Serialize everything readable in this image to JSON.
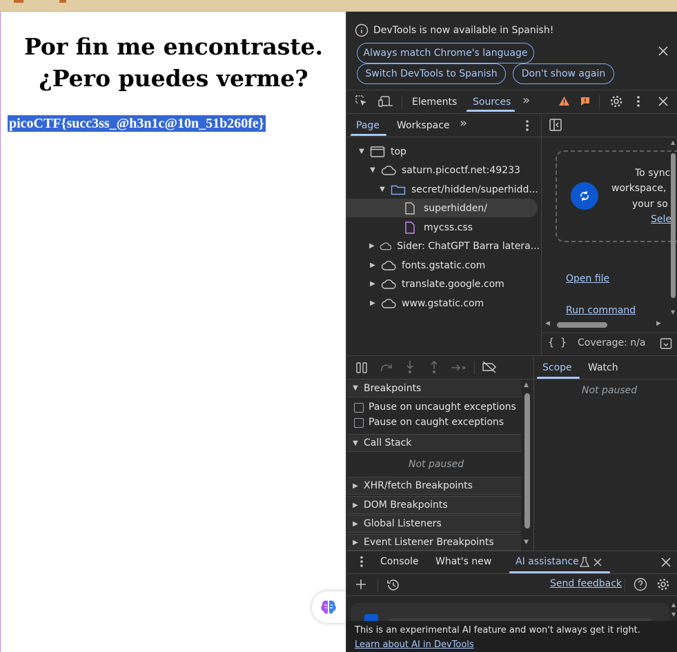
{
  "page": {
    "heading_line1": "Por fin me encontraste.",
    "heading_line2": "¿Pero puedes verme?",
    "flag_text": "picoCTF{succ3ss_@h3n1c@10n_51b260fe}"
  },
  "devtools": {
    "banner": {
      "message": "DevTools is now available in Spanish!",
      "always_match": "Always match Chrome's language",
      "switch_spanish": "Switch DevTools to Spanish",
      "dont_show": "Don't show again"
    },
    "main_tabs": {
      "elements": "Elements",
      "sources": "Sources"
    },
    "nav_tabs": {
      "page": "Page",
      "workspace": "Workspace"
    },
    "tree": {
      "top": "top",
      "saturn": "saturn.picoctf.net:49233",
      "secret": "secret/hidden/superhidd...",
      "superhidden": "superhidden/",
      "mycss": "mycss.css",
      "sider": "Sider: ChatGPT Barra latera...",
      "fonts": "fonts.gstatic.com",
      "translate": "translate.google.com",
      "gstatic": "www.gstatic.com"
    },
    "workspace_panel": {
      "line1": "To sync",
      "line2": "workspace,",
      "line3": "your so",
      "link": "Sele",
      "open_file": "Open file",
      "run_command": "Run command"
    },
    "coverage": "Coverage: n/a",
    "debugger": {
      "breakpoints": "Breakpoints",
      "pause_uncaught": "Pause on uncaught exceptions",
      "pause_caught": "Pause on caught exceptions",
      "call_stack": "Call Stack",
      "not_paused": "Not paused",
      "xhr": "XHR/fetch Breakpoints",
      "dom": "DOM Breakpoints",
      "global": "Global Listeners",
      "event": "Event Listener Breakpoints"
    },
    "scope_tabs": {
      "scope": "Scope",
      "watch": "Watch",
      "not_paused": "Not paused"
    },
    "drawer_tabs": {
      "console": "Console",
      "whats_new": "What's new",
      "ai": "AI assistance"
    },
    "ai": {
      "send_feedback": "Send feedback",
      "disclaimer": "This is an experimental AI feature and won't always get it right.",
      "learn_more": "Learn about AI in DevTools"
    },
    "colors": {
      "background": "#282828",
      "accent": "#a8c7fa",
      "warning": "#f28b54"
    }
  }
}
